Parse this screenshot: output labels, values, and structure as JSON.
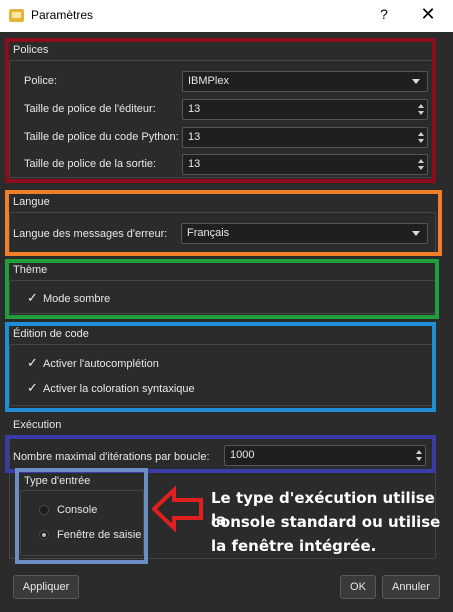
{
  "window": {
    "title": "Paramètres",
    "help": "?",
    "close": "✕"
  },
  "polices": {
    "section": "Polices",
    "font_label": "Police:",
    "font_value": "IBMPlex",
    "editor_size_label": "Taille de police de l'éditeur:",
    "editor_size_value": "13",
    "python_size_label": "Taille de police du code Python:",
    "python_size_value": "13",
    "output_size_label": "Taille de police de la sortie:",
    "output_size_value": "13"
  },
  "langue": {
    "section": "Langue",
    "error_lang_label": "Langue des messages d'erreur:",
    "error_lang_value": "Français"
  },
  "theme": {
    "section": "Thème",
    "dark_mode": "Mode sombre",
    "dark_mode_checked": true
  },
  "edition": {
    "section": "Édition de code",
    "autocomplete": "Activer l'autocomplétion",
    "autocomplete_checked": true,
    "syntax": "Activer la coloration syntaxique",
    "syntax_checked": true
  },
  "execution": {
    "section": "Exécution",
    "max_iter_label": "Nombre maximal d'itérations par boucle:",
    "max_iter_value": "1000",
    "input_type_title": "Type d'entrée",
    "options": [
      "Console",
      "Fenêtre de saisie"
    ],
    "selected": "Fenêtre de saisie"
  },
  "annotation": {
    "text_lines": [
      "Le type d'exécution utilise la",
      "console standard ou utilise",
      "la fenêtre intégrée."
    ],
    "colors": {
      "polices": "#8b0e1c",
      "langue": "#f07f27",
      "theme": "#1f9e3c",
      "edition": "#1e8fd6",
      "execution": "#3a3aa8",
      "input_type": "#6b8fc5",
      "arrow": "#e02020"
    }
  },
  "buttons": {
    "apply": "Appliquer",
    "ok": "OK",
    "cancel": "Annuler"
  },
  "icons": {
    "check": "✓",
    "app": "folder-icon"
  }
}
